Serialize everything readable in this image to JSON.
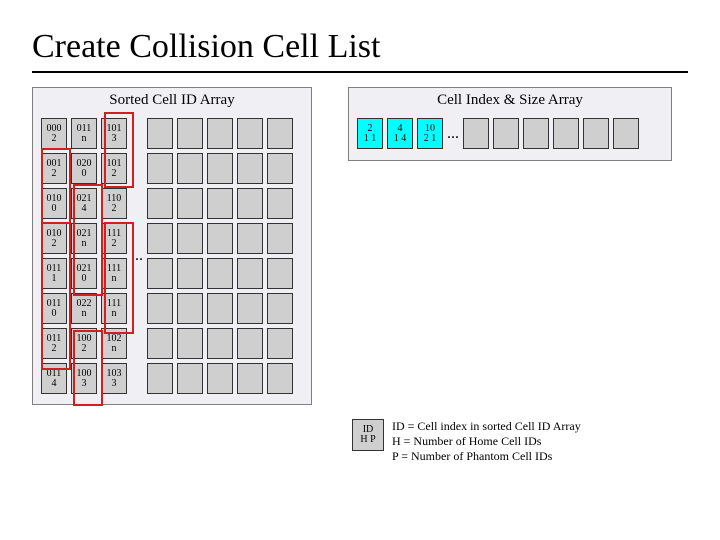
{
  "title": "Create Collision Cell List",
  "left": {
    "heading": "Sorted Cell ID Array",
    "rows": [
      [
        [
          "000",
          "2"
        ],
        [
          "011",
          "n"
        ],
        [
          "101",
          "3"
        ]
      ],
      [
        [
          "001",
          "2"
        ],
        [
          "020",
          "0"
        ],
        [
          "101",
          "2"
        ]
      ],
      [
        [
          "010",
          "0"
        ],
        [
          "021",
          "4"
        ],
        [
          "110",
          "2"
        ]
      ],
      [
        [
          "010",
          "2"
        ],
        [
          "021",
          "n"
        ],
        [
          "111",
          "2"
        ]
      ],
      [
        [
          "011",
          "1"
        ],
        [
          "021",
          "0"
        ],
        [
          "111",
          "n"
        ]
      ],
      [
        [
          "011",
          "0"
        ],
        [
          "022",
          "n"
        ],
        [
          "111",
          "n"
        ]
      ],
      [
        [
          "011",
          "2"
        ],
        [
          "100",
          "2"
        ],
        [
          "102",
          "n"
        ]
      ],
      [
        [
          "011",
          "4"
        ],
        [
          "100",
          "3"
        ],
        [
          "103",
          "3"
        ]
      ]
    ],
    "blank_cols": 5,
    "ellipsis": "..."
  },
  "right": {
    "heading": "Cell Index & Size Array",
    "filled": [
      [
        "2",
        "1 1"
      ],
      [
        "4",
        "1 4"
      ],
      [
        "10",
        "2 1"
      ]
    ],
    "blank_cols": 6,
    "ellipsis": "..."
  },
  "legend": {
    "key_top": "ID",
    "key_bot": "H  P",
    "lines": [
      "ID = Cell index in sorted Cell ID Array",
      "H = Number of Home Cell IDs",
      "P = Number of Phantom Cell IDs"
    ]
  }
}
